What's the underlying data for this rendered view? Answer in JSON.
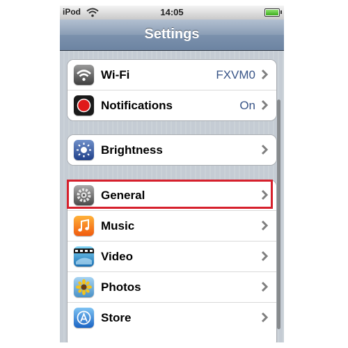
{
  "status_bar": {
    "carrier": "iPod",
    "time": "14:05",
    "battery_level": 1.0
  },
  "nav": {
    "title": "Settings"
  },
  "groups": [
    {
      "rows": [
        {
          "label": "Wi-Fi",
          "value": "FXVM0",
          "icon": "wifi-icon"
        },
        {
          "label": "Notifications",
          "value": "On",
          "icon": "notifications-icon"
        }
      ]
    },
    {
      "rows": [
        {
          "label": "Brightness",
          "value": "",
          "icon": "brightness-icon"
        }
      ]
    },
    {
      "rows": [
        {
          "label": "General",
          "value": "",
          "icon": "gear-icon"
        },
        {
          "label": "Music",
          "value": "",
          "icon": "music-icon"
        },
        {
          "label": "Video",
          "value": "",
          "icon": "video-icon"
        },
        {
          "label": "Photos",
          "value": "",
          "icon": "photos-icon"
        },
        {
          "label": "Store",
          "value": "",
          "icon": "store-icon"
        }
      ]
    }
  ],
  "colors": {
    "value_blue": "#385487",
    "highlight_red": "#d6202c",
    "nav_blue": "#6d84a2"
  }
}
